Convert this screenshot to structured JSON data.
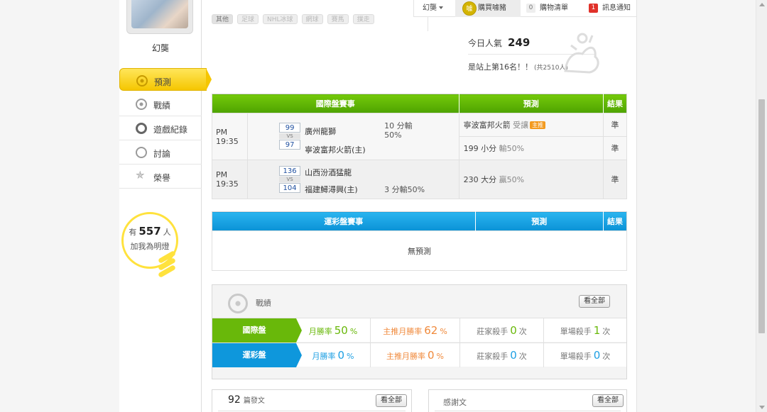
{
  "topbar": {
    "user_menu": "幻龑",
    "buy_label": "購買噱豬",
    "buy_icon_text": "噱",
    "cart_count": "0",
    "cart_label": "購物清單",
    "notify_count": "1",
    "notify_label": "訊息通知"
  },
  "tags": [
    "其他",
    "足球",
    "NHL冰球",
    "網球",
    "賽馬",
    "撲走"
  ],
  "user": {
    "name": "幻龑",
    "nav": [
      {
        "label": "預測",
        "icon": "target-icon"
      },
      {
        "label": "戰績",
        "icon": "record-icon"
      },
      {
        "label": "遊戲紀錄",
        "icon": "ring-icon"
      },
      {
        "label": "討論",
        "icon": "chat-icon"
      },
      {
        "label": "榮譽",
        "icon": "medal-icon"
      }
    ],
    "fans_prefix": "有",
    "fans_count": "557",
    "fans_suffix": "人",
    "fans_line2": "加我為明燈"
  },
  "popularity": {
    "label": "今日人氣",
    "value": "249",
    "rank_text": "是站上第16名！！",
    "total_text": "(共2510人)"
  },
  "intl_table": {
    "headers": [
      "國際盤賽事",
      "預測",
      "結果"
    ],
    "games": [
      {
        "time": "PM 19:35",
        "score_home": "99",
        "vs": "VS",
        "score_away": "97",
        "team1": "廣州龍獅",
        "team2": "寧波富邦火箭(主)",
        "line1": "10 分輸",
        "line2": "50%",
        "preds": [
          {
            "text": "寧波富邦火箭",
            "extra": "受讓",
            "badge": "主推",
            "result": "準"
          },
          {
            "text": "199 小分",
            "extra": "輸50%",
            "result": "準"
          }
        ]
      },
      {
        "time": "PM 19:35",
        "score_home": "136",
        "vs": "VS",
        "score_away": "104",
        "team1": "山西汾酒猛龍",
        "team2": "福建鱘潯興(主)",
        "line1": "3 分輸50%",
        "preds": [
          {
            "text": "230 大分",
            "extra": "贏50%",
            "result": "準"
          }
        ]
      }
    ]
  },
  "lottery_table": {
    "headers": [
      "運彩盤賽事",
      "預測",
      "結果"
    ],
    "empty": "無預測"
  },
  "record": {
    "title": "戰績",
    "all_button": "看全部",
    "rows": [
      {
        "label": "國際盤",
        "month_label": "月勝率",
        "month_value": "50",
        "month_unit": "%",
        "main_label": "主推月勝率",
        "main_value": "62",
        "main_unit": "%",
        "dealer_label": "莊家殺手",
        "dealer_value": "0",
        "dealer_unit": "次",
        "single_label": "單場殺手",
        "single_value": "1",
        "single_unit": "次"
      },
      {
        "label": "運彩盤",
        "month_label": "月勝率",
        "month_value": "0",
        "month_unit": "%",
        "main_label": "主推月勝率",
        "main_value": "0",
        "main_unit": "%",
        "dealer_label": "莊家殺手",
        "dealer_value": "0",
        "dealer_unit": "次",
        "single_label": "單場殺手",
        "single_value": "0",
        "single_unit": "次"
      }
    ]
  },
  "posts": {
    "count": "92",
    "label": "篇發文",
    "button": "看全部"
  },
  "thanks": {
    "title": "感謝文",
    "button": "看全部"
  },
  "colors": {
    "green": "#69b80a",
    "blue": "#0e97dc",
    "yellow": "#f5c600",
    "orange": "#f08a3c"
  }
}
